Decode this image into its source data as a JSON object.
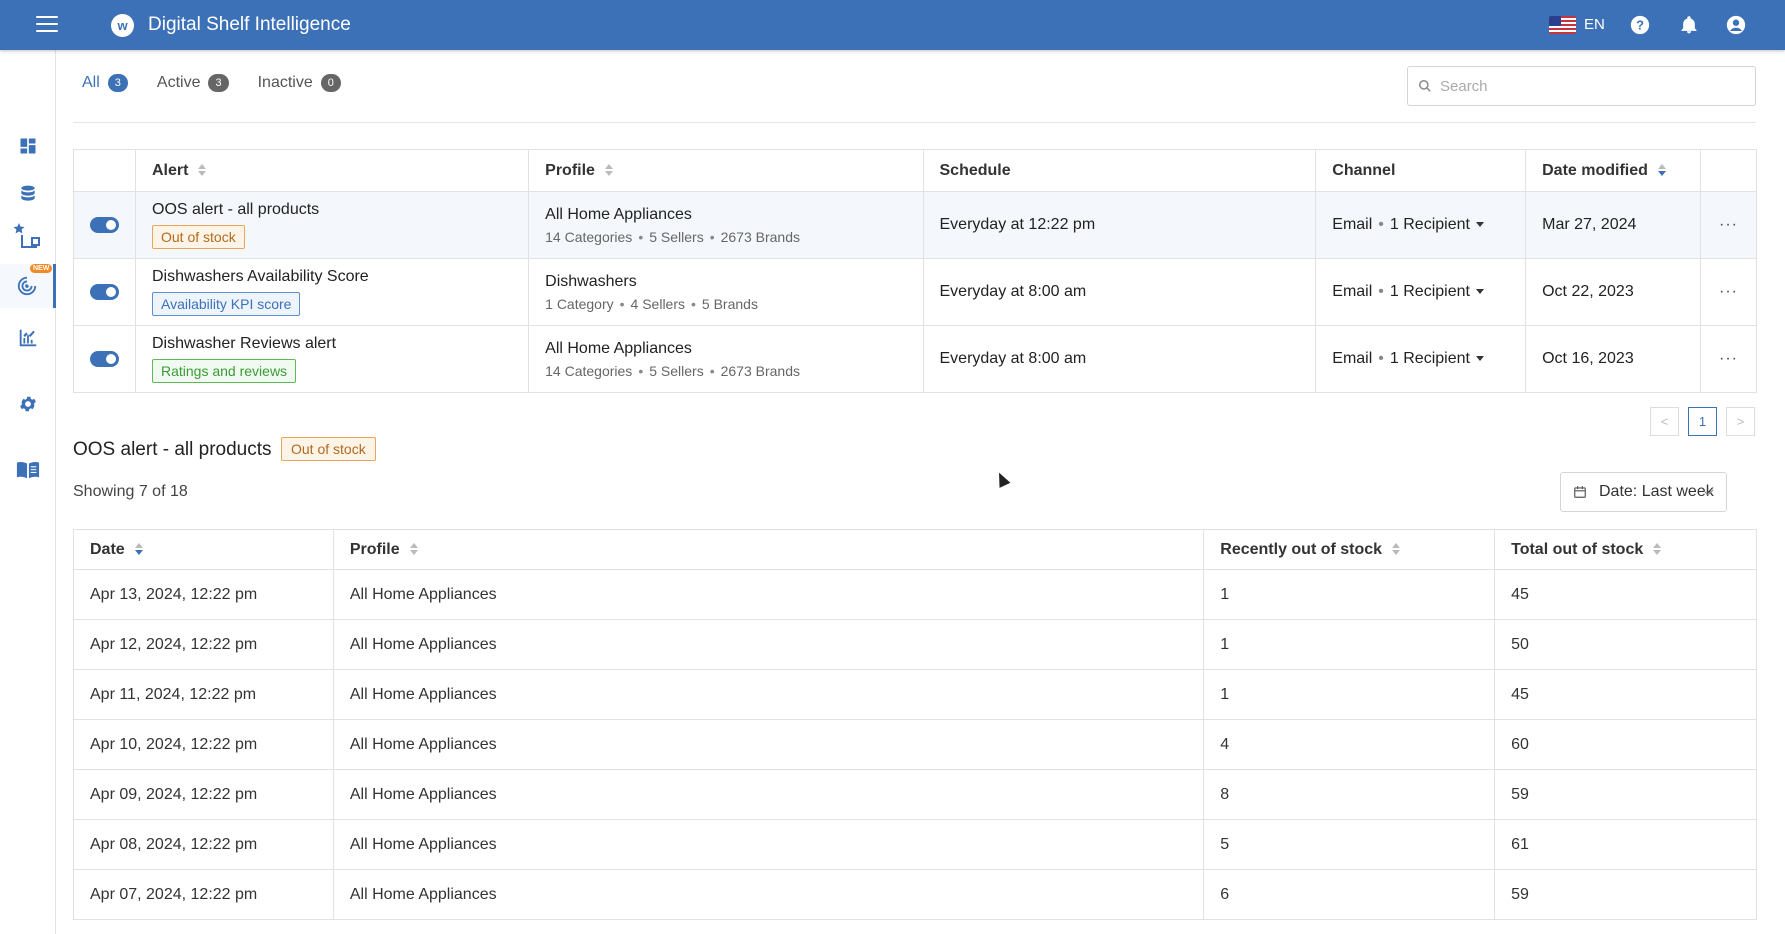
{
  "header": {
    "app_title": "Digital Shelf Intelligence",
    "logo_letter": "w",
    "language": "EN"
  },
  "sidebar": {
    "new_badge": "NEW",
    "items": [
      "dashboard",
      "database",
      "star-devices",
      "alerts",
      "analytics",
      "settings",
      "docs"
    ]
  },
  "tabs": [
    {
      "label": "All",
      "count": "3"
    },
    {
      "label": "Active",
      "count": "3"
    },
    {
      "label": "Inactive",
      "count": "0"
    }
  ],
  "search": {
    "placeholder": "Search"
  },
  "alerts_table": {
    "columns": [
      "Alert",
      "Profile",
      "Schedule",
      "Channel",
      "Date modified"
    ],
    "rows": [
      {
        "name": "OOS alert - all products",
        "tag": "Out of stock",
        "profile": "All Home Appliances",
        "categories": "14 Categories",
        "sellers": "5 Sellers",
        "brands": "2673 Brands",
        "schedule": "Everyday at 12:22 pm",
        "channel": "Email",
        "recipients": "1 Recipient",
        "modified": "Mar 27, 2024"
      },
      {
        "name": "Dishwashers Availability Score",
        "tag": "Availability KPI score",
        "profile": "Dishwashers",
        "categories": "1 Category",
        "sellers": "4 Sellers",
        "brands": "5 Brands",
        "schedule": "Everyday at 8:00 am",
        "channel": "Email",
        "recipients": "1 Recipient",
        "modified": "Oct 22, 2023"
      },
      {
        "name": "Dishwasher Reviews alert",
        "tag": "Ratings and reviews",
        "profile": "All Home Appliances",
        "categories": "14 Categories",
        "sellers": "5 Sellers",
        "brands": "2673 Brands",
        "schedule": "Everyday at 8:00 am",
        "channel": "Email",
        "recipients": "1 Recipient",
        "modified": "Oct 16, 2023"
      }
    ]
  },
  "pagination": {
    "prev": "<",
    "current": "1",
    "next": ">"
  },
  "detail": {
    "title": "OOS alert - all products",
    "tag": "Out of stock",
    "showing": "Showing 7 of 18",
    "date_filter": "Date: Last week"
  },
  "history_table": {
    "columns": [
      "Date",
      "Profile",
      "Recently out of stock",
      "Total out of stock"
    ],
    "rows": [
      [
        "Apr 13, 2024, 12:22 pm",
        "All Home Appliances",
        "1",
        "45"
      ],
      [
        "Apr 12, 2024, 12:22 pm",
        "All Home Appliances",
        "1",
        "50"
      ],
      [
        "Apr 11, 2024, 12:22 pm",
        "All Home Appliances",
        "1",
        "45"
      ],
      [
        "Apr 10, 2024, 12:22 pm",
        "All Home Appliances",
        "4",
        "60"
      ],
      [
        "Apr 09, 2024, 12:22 pm",
        "All Home Appliances",
        "8",
        "59"
      ],
      [
        "Apr 08, 2024, 12:22 pm",
        "All Home Appliances",
        "5",
        "61"
      ],
      [
        "Apr 07, 2024, 12:22 pm",
        "All Home Appliances",
        "6",
        "59"
      ]
    ]
  },
  "colors": {
    "brand": "#3c71b8",
    "out_of_stock": "#e8a657",
    "kpi": "#5d90cf",
    "ratings": "#5dba58"
  }
}
